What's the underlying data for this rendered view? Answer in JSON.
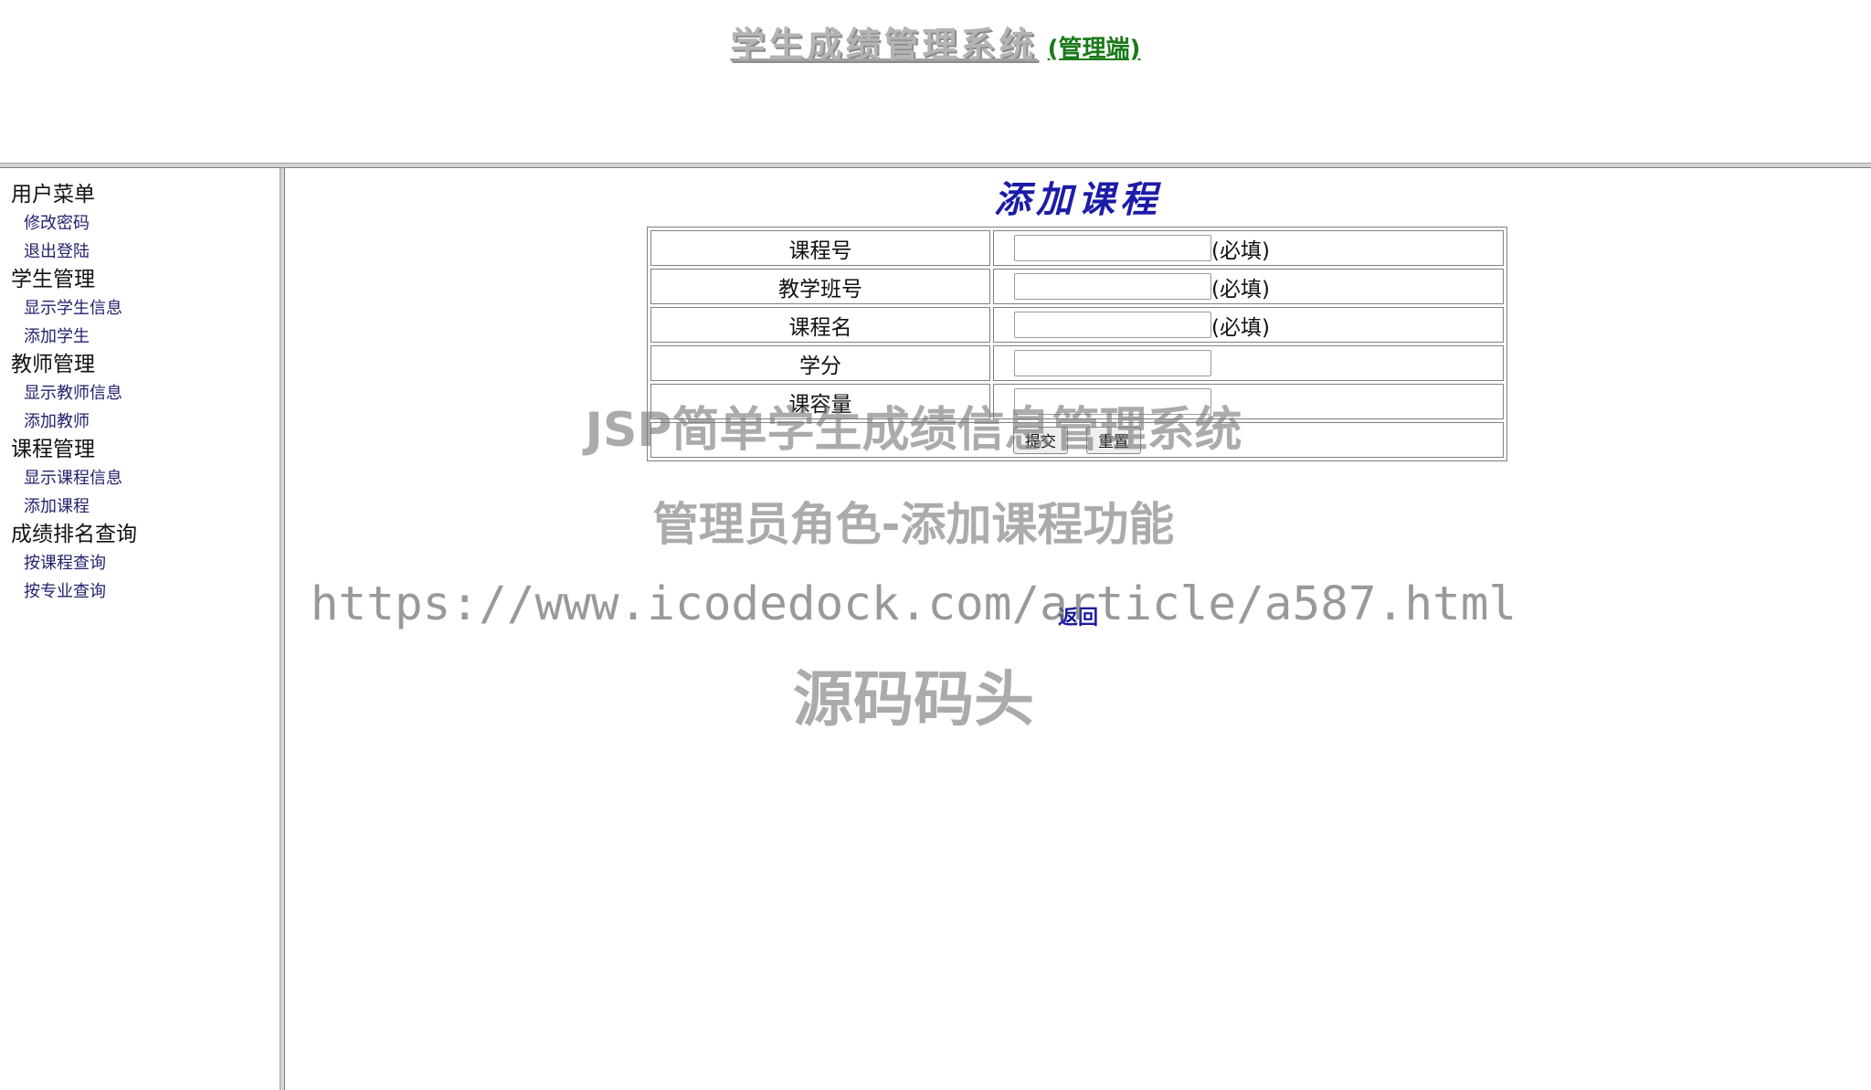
{
  "header": {
    "site_title": "学生成绩管理系统",
    "role_label": "(管理端)"
  },
  "sidebar": {
    "groups": [
      {
        "title": "用户菜单",
        "items": [
          "修改密码",
          "退出登陆"
        ]
      },
      {
        "title": "学生管理",
        "items": [
          "显示学生信息",
          "添加学生"
        ]
      },
      {
        "title": "教师管理",
        "items": [
          "显示教师信息",
          "添加教师"
        ]
      },
      {
        "title": "课程管理",
        "items": [
          "显示课程信息",
          "添加课程"
        ]
      },
      {
        "title": "成绩排名查询",
        "items": [
          "按课程查询",
          "按专业查询"
        ]
      }
    ]
  },
  "main": {
    "heading": "添加课程",
    "form": {
      "fields": [
        {
          "label": "课程号",
          "value": "",
          "required_note": "(必填)"
        },
        {
          "label": "教学班号",
          "value": "",
          "required_note": "(必填)"
        },
        {
          "label": "课程名",
          "value": "",
          "required_note": "(必填)"
        },
        {
          "label": "学分",
          "value": "",
          "required_note": ""
        },
        {
          "label": "课容量",
          "value": "",
          "required_note": ""
        }
      ],
      "submit_label": "提交",
      "reset_label": "重置"
    },
    "back_label": "返回"
  },
  "watermark": {
    "line1": "JSP简单学生成绩信息管理系统",
    "line2": "管理员角色-添加课程功能",
    "line3": "https://www.icodedock.com/article/a587.html",
    "line4": "源码码头"
  },
  "colors": {
    "heading": "#1c1ca8",
    "role_label": "#1a7a1a",
    "menu_link": "#22226e"
  }
}
